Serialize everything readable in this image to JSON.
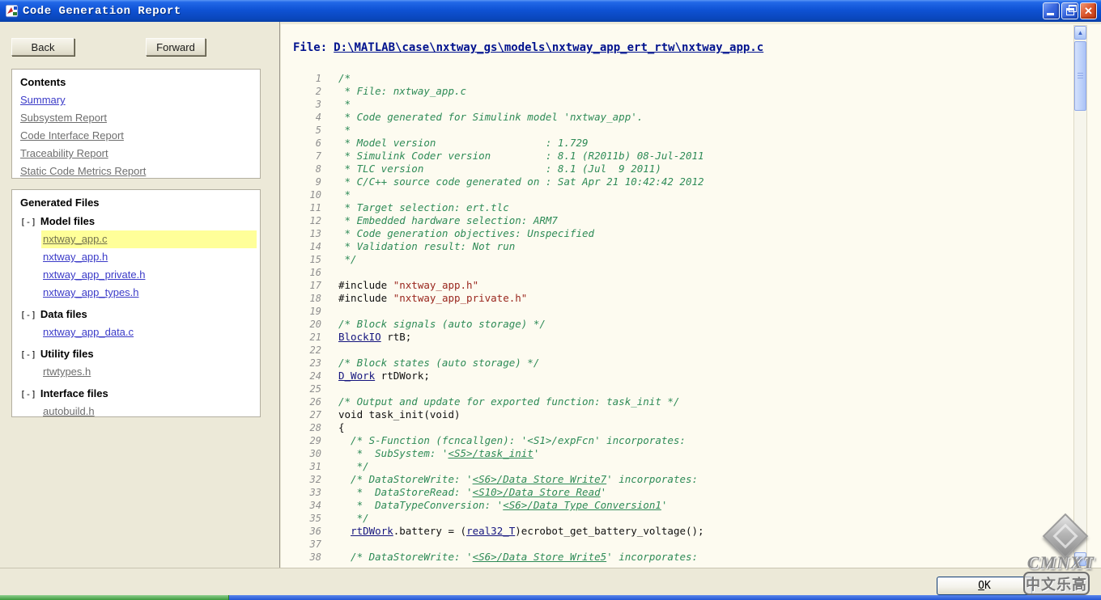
{
  "window": {
    "title": "Code Generation Report"
  },
  "toolbar": {
    "back_label": "Back",
    "forward_label": "Forward"
  },
  "sidebar": {
    "contents": {
      "heading": "Contents",
      "links": [
        {
          "label": "Summary",
          "style": "blue"
        },
        {
          "label": "Subsystem Report",
          "style": "gray"
        },
        {
          "label": "Code Interface Report",
          "style": "gray"
        },
        {
          "label": "Traceability Report",
          "style": "gray"
        },
        {
          "label": "Static Code Metrics Report",
          "style": "gray"
        }
      ]
    },
    "generated_files": {
      "heading": "Generated Files",
      "sections": [
        {
          "toggle": "[-]",
          "label": "Model files",
          "files": [
            {
              "label": "nxtway_app.c",
              "style": "blue",
              "selected": true
            },
            {
              "label": "nxtway_app.h",
              "style": "blue"
            },
            {
              "label": "nxtway_app_private.h",
              "style": "blue"
            },
            {
              "label": "nxtway_app_types.h",
              "style": "blue"
            }
          ]
        },
        {
          "toggle": "[-]",
          "label": "Data files",
          "files": [
            {
              "label": "nxtway_app_data.c",
              "style": "blue"
            }
          ]
        },
        {
          "toggle": "[-]",
          "label": "Utility files",
          "files": [
            {
              "label": "rtwtypes.h",
              "style": "gray"
            }
          ]
        },
        {
          "toggle": "[-]",
          "label": "Interface files",
          "files": [
            {
              "label": "autobuild.h",
              "style": "gray"
            }
          ]
        }
      ]
    }
  },
  "main": {
    "file_label": "File:",
    "file_path": "D:\\MATLAB\\case\\nxtway_gs\\models\\nxtway_app_ert_rtw\\nxtway_app.c",
    "code_lines": [
      {
        "n": 1,
        "segs": [
          {
            "t": "/*",
            "c": "cm"
          }
        ]
      },
      {
        "n": 2,
        "segs": [
          {
            "t": " * File: nxtway_app.c",
            "c": "cm"
          }
        ]
      },
      {
        "n": 3,
        "segs": [
          {
            "t": " *",
            "c": "cm"
          }
        ]
      },
      {
        "n": 4,
        "segs": [
          {
            "t": " * Code generated for Simulink model 'nxtway_app'.",
            "c": "cm"
          }
        ]
      },
      {
        "n": 5,
        "segs": [
          {
            "t": " *",
            "c": "cm"
          }
        ]
      },
      {
        "n": 6,
        "segs": [
          {
            "t": " * Model version                  : 1.729",
            "c": "cm"
          }
        ]
      },
      {
        "n": 7,
        "segs": [
          {
            "t": " * Simulink Coder version         : 8.1 (R2011b) 08-Jul-2011",
            "c": "cm"
          }
        ]
      },
      {
        "n": 8,
        "segs": [
          {
            "t": " * TLC version                    : 8.1 (Jul  9 2011)",
            "c": "cm"
          }
        ]
      },
      {
        "n": 9,
        "segs": [
          {
            "t": " * C/C++ source code generated on : Sat Apr 21 10:42:42 2012",
            "c": "cm"
          }
        ]
      },
      {
        "n": 10,
        "segs": [
          {
            "t": " *",
            "c": "cm"
          }
        ]
      },
      {
        "n": 11,
        "segs": [
          {
            "t": " * Target selection: ert.tlc",
            "c": "cm"
          }
        ]
      },
      {
        "n": 12,
        "segs": [
          {
            "t": " * Embedded hardware selection: ARM7",
            "c": "cm"
          }
        ]
      },
      {
        "n": 13,
        "segs": [
          {
            "t": " * Code generation objectives: Unspecified",
            "c": "cm"
          }
        ]
      },
      {
        "n": 14,
        "segs": [
          {
            "t": " * Validation result: Not run",
            "c": "cm"
          }
        ]
      },
      {
        "n": 15,
        "segs": [
          {
            "t": " */",
            "c": "cm"
          }
        ]
      },
      {
        "n": 16,
        "segs": []
      },
      {
        "n": 17,
        "segs": [
          {
            "t": "#include ",
            "c": "tx"
          },
          {
            "t": "\"nxtway_app.h\"",
            "c": "st"
          }
        ]
      },
      {
        "n": 18,
        "segs": [
          {
            "t": "#include ",
            "c": "tx"
          },
          {
            "t": "\"nxtway_app_private.h\"",
            "c": "st"
          }
        ]
      },
      {
        "n": 19,
        "segs": []
      },
      {
        "n": 20,
        "segs": [
          {
            "t": "/* Block signals (auto storage) */",
            "c": "cm"
          }
        ]
      },
      {
        "n": 21,
        "segs": [
          {
            "t": "BlockIO",
            "c": "ln"
          },
          {
            "t": " rtB;",
            "c": "tx"
          }
        ]
      },
      {
        "n": 22,
        "segs": []
      },
      {
        "n": 23,
        "segs": [
          {
            "t": "/* Block states (auto storage) */",
            "c": "cm"
          }
        ]
      },
      {
        "n": 24,
        "segs": [
          {
            "t": "D_Work",
            "c": "ln"
          },
          {
            "t": " rtDWork;",
            "c": "tx"
          }
        ]
      },
      {
        "n": 25,
        "segs": []
      },
      {
        "n": 26,
        "segs": [
          {
            "t": "/* Output and update for exported function: task_init */",
            "c": "cm"
          }
        ]
      },
      {
        "n": 27,
        "segs": [
          {
            "t": "void task_init(void)",
            "c": "tx"
          }
        ]
      },
      {
        "n": 28,
        "segs": [
          {
            "t": "{",
            "c": "tx"
          }
        ]
      },
      {
        "n": 29,
        "segs": [
          {
            "t": "  /* S-Function (fcncallgen): '<S1>/expFcn' incorporates:",
            "c": "cm"
          }
        ]
      },
      {
        "n": 30,
        "segs": [
          {
            "t": "   *  SubSystem: '",
            "c": "cm"
          },
          {
            "t": "<S5>/task_init",
            "c": "cl"
          },
          {
            "t": "'",
            "c": "cm"
          }
        ]
      },
      {
        "n": 31,
        "segs": [
          {
            "t": "   */",
            "c": "cm"
          }
        ]
      },
      {
        "n": 32,
        "segs": [
          {
            "t": "  /* DataStoreWrite: '",
            "c": "cm"
          },
          {
            "t": "<S6>/Data Store Write7",
            "c": "cl"
          },
          {
            "t": "' incorporates:",
            "c": "cm"
          }
        ]
      },
      {
        "n": 33,
        "segs": [
          {
            "t": "   *  DataStoreRead: '",
            "c": "cm"
          },
          {
            "t": "<S10>/Data Store Read",
            "c": "cl"
          },
          {
            "t": "'",
            "c": "cm"
          }
        ]
      },
      {
        "n": 34,
        "segs": [
          {
            "t": "   *  DataTypeConversion: '",
            "c": "cm"
          },
          {
            "t": "<S6>/Data Type Conversion1",
            "c": "cl"
          },
          {
            "t": "'",
            "c": "cm"
          }
        ]
      },
      {
        "n": 35,
        "segs": [
          {
            "t": "   */",
            "c": "cm"
          }
        ]
      },
      {
        "n": 36,
        "segs": [
          {
            "t": "  ",
            "c": "tx"
          },
          {
            "t": "rtDWork",
            "c": "ln"
          },
          {
            "t": ".battery = (",
            "c": "tx"
          },
          {
            "t": "real32_T",
            "c": "ln"
          },
          {
            "t": ")ecrobot_get_battery_voltage();",
            "c": "tx"
          }
        ]
      },
      {
        "n": 37,
        "segs": []
      },
      {
        "n": 38,
        "segs": [
          {
            "t": "  /* DataStoreWrite: '",
            "c": "cm"
          },
          {
            "t": "<S6>/Data Store Write5",
            "c": "cl"
          },
          {
            "t": "' incorporates:",
            "c": "cm"
          }
        ]
      }
    ]
  },
  "footer": {
    "ok_accel": "O",
    "ok_rest": "K"
  },
  "watermark": {
    "brand": "CMNXT",
    "caption": "中文乐高"
  },
  "colors": {
    "titlebar_blue": "#0f52d4",
    "close_red": "#c03a14",
    "sidebar_bg": "#ECE9D8",
    "selection_yellow": "#FFFF99",
    "link_blue": "#3B3BC8",
    "link_gray": "#6e6e6e",
    "code_bg": "#FDFBF0",
    "comment_green": "#2E8B57",
    "code_link_navy": "#14147E",
    "string_maroon": "#99261d",
    "file_header_navy": "#00128E",
    "progress_green": "#3E9A3E"
  }
}
